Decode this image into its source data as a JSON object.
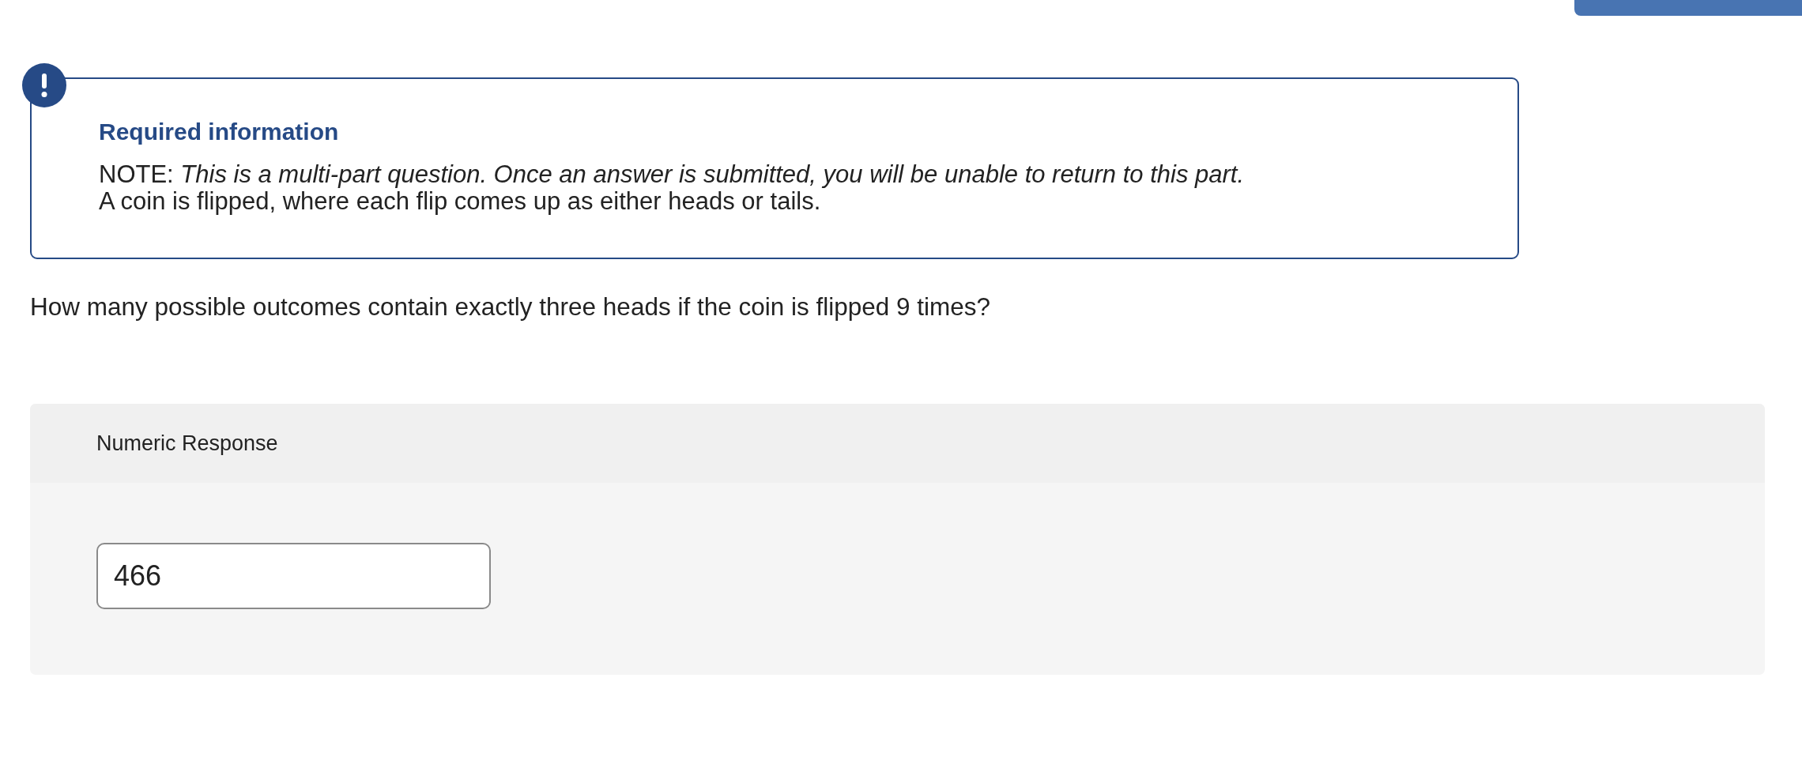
{
  "alert": {
    "title": "Required information",
    "paragraphs": [
      "NOTE: *This is a multi-part question. Once an answer is submitted, you will be unable to return to this part.*",
      "A coin is flipped, where each flip comes up as either heads or tails."
    ]
  },
  "question": "How many possible outcomes contain exactly three heads if the coin is flipped 9 times?",
  "response": {
    "label": "Numeric Response",
    "value": "466"
  }
}
